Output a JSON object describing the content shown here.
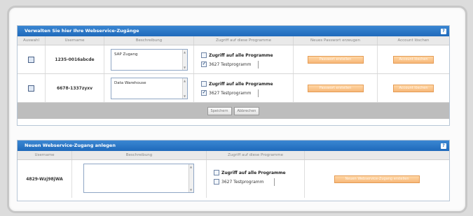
{
  "panel1": {
    "title": "Verwalten Sie hier Ihre Webservice-Zugänge",
    "help_label": "?",
    "columns": [
      "Auswahl",
      "Username",
      "Beschreibung",
      "Zugriff auf diese Programme",
      "Neues Passwort erzeugen",
      "Account löschen"
    ],
    "rows": [
      {
        "username": "1235-0016abcde",
        "description": "SAP Zugang",
        "all_programs_label": "Zugriff auf alle Programme",
        "program_label": "3627 Testprogramm",
        "password_button": "Passwort erstellen",
        "delete_button": "Account löschen"
      },
      {
        "username": "6678-1337zyxv",
        "description": "Data Warehouse",
        "all_programs_label": "Zugriff auf alle Programme",
        "program_label": "3627 Testprogramm",
        "password_button": "Passwort erstellen",
        "delete_button": "Account löschen"
      }
    ],
    "save_button": "Speichern",
    "cancel_button": "Abbrechen"
  },
  "panel2": {
    "title": "Neuen Webservice-Zugang anlegen",
    "help_label": "?",
    "columns": [
      "Username",
      "Beschreibung",
      "Zugriff auf diese Programme",
      ""
    ],
    "row": {
      "username": "4829-Wzj98jWA",
      "description": "",
      "all_programs_label": "Zugriff auf alle Programme",
      "program_label": "3627  Testprogramm",
      "create_button": "Neuen Webservice-Zugang erstellen"
    }
  }
}
